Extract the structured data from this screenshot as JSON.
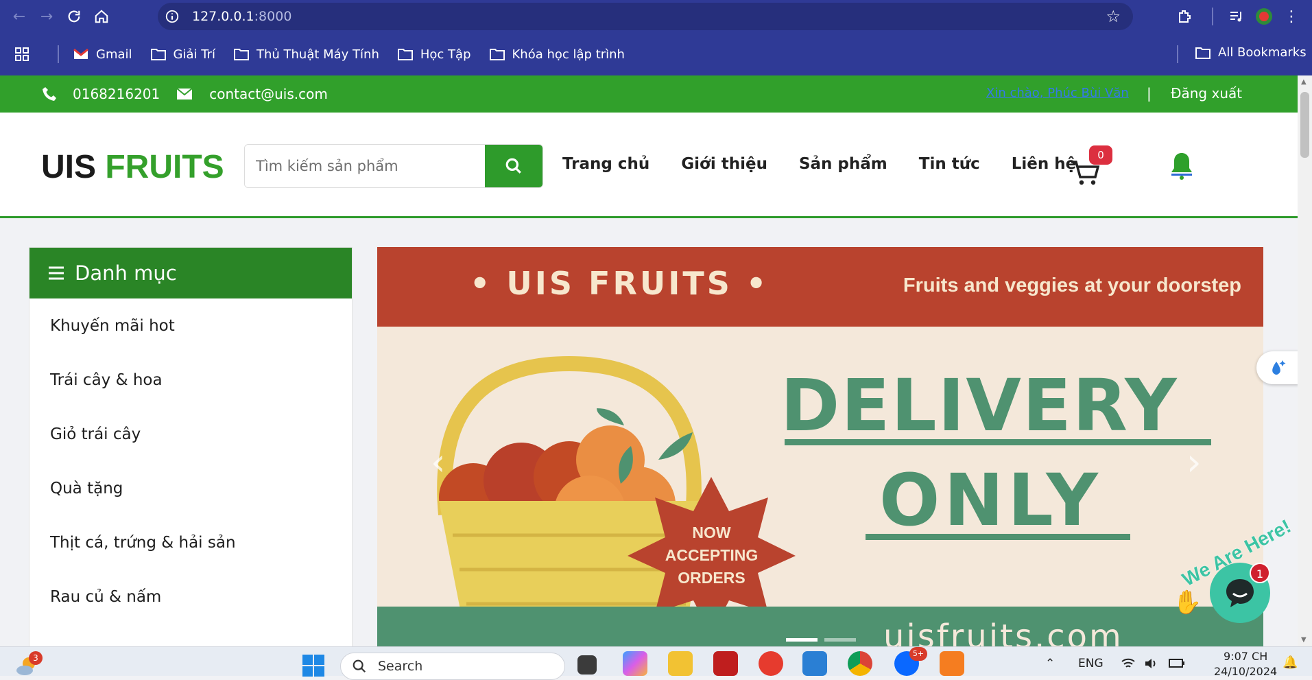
{
  "browser": {
    "url_host": "127.0.0.1",
    "url_port": ":8000",
    "bookmarks": [
      {
        "label": "Gmail",
        "icon": "gmail-icon"
      },
      {
        "label": "Giải Trí",
        "icon": "folder-icon"
      },
      {
        "label": "Thủ Thuật Máy Tính",
        "icon": "folder-icon"
      },
      {
        "label": "Học Tập",
        "icon": "folder-icon"
      },
      {
        "label": "Khóa học lập trình",
        "icon": "folder-icon"
      }
    ],
    "all_bookmarks": "All Bookmarks"
  },
  "topbar": {
    "phone": "0168216201",
    "email": "contact@uis.com",
    "greeting": "Xin chào, Phúc Bùi Văn",
    "separator": "|",
    "logout": "Đăng xuất",
    "color": "#31a02b"
  },
  "header": {
    "logo_left": "UIS",
    "logo_right": "FRUITS",
    "search_placeholder": "Tìm kiếm sản phẩm",
    "menu": [
      "Trang chủ",
      "Giới thiệu",
      "Sản phẩm",
      "Tin tức",
      "Liên hệ"
    ],
    "cart_count": "0"
  },
  "sidebar": {
    "title": "Danh mục",
    "items": [
      "Khuyến mãi hot",
      "Trái cây & hoa",
      "Giỏ trái cây",
      "Quà tặng",
      "Thịt cá, trứng & hải sản",
      "Rau củ & nấm"
    ]
  },
  "banner": {
    "brand": "• UIS FRUITS •",
    "tagline": "Fruits and veggies at your doorstep",
    "headline1": "DELIVERY",
    "headline2": "ONLY",
    "badge_line1": "NOW",
    "badge_line2": "ACCEPTING",
    "badge_line3": "ORDERS",
    "site": "uisfruits.com",
    "slide_active": 1,
    "slide_count": 2
  },
  "widgets": {
    "chat_label": "We Are Here!",
    "chat_badge": "1"
  },
  "taskbar": {
    "weather_badge": "3",
    "search": "Search",
    "zalo_badge": "5+",
    "lang": "ENG",
    "time": "9:07 CH",
    "date": "24/10/2024"
  }
}
